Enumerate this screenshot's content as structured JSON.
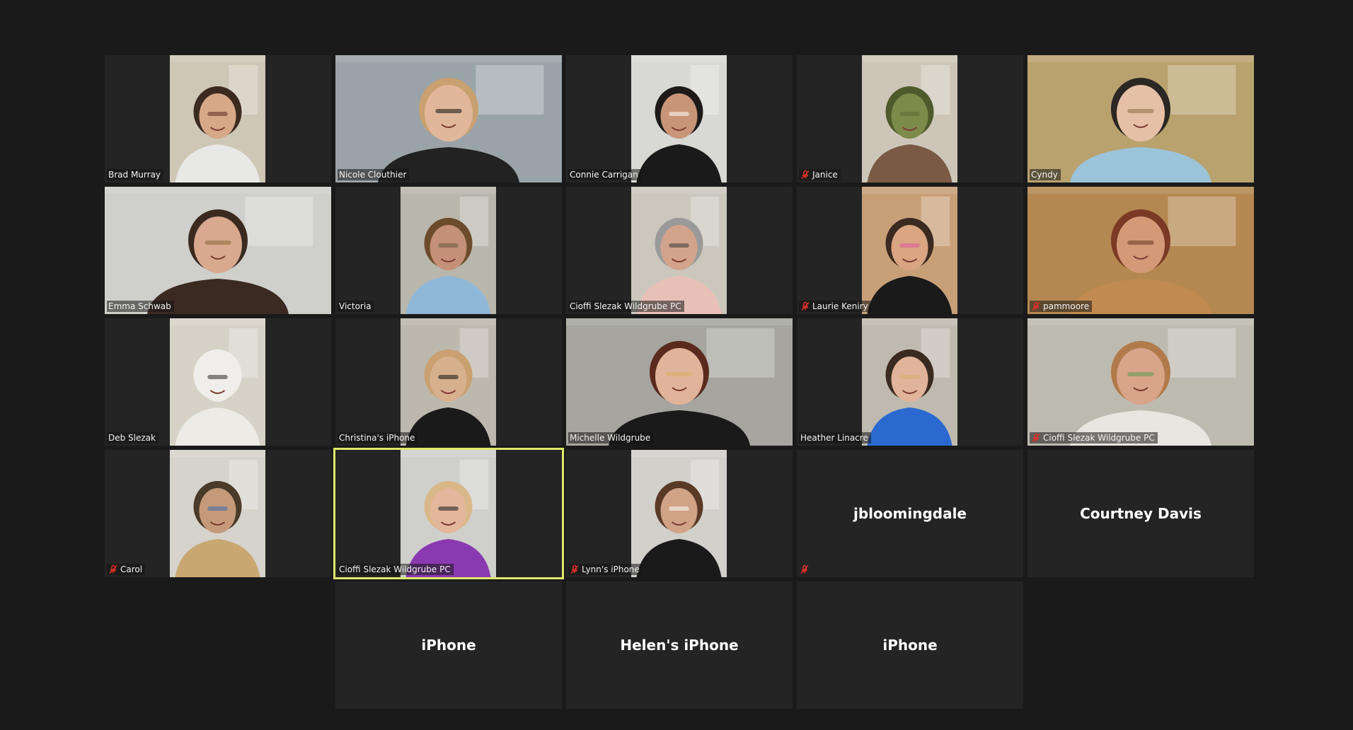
{
  "participants": [
    {
      "name": "Brad Murray",
      "muted": false,
      "video": "narrow",
      "scene": {
        "wall": "#cfc7b6",
        "skin": "#d7a888",
        "hair": "#3a2a20",
        "clothes": "#e8e8e6",
        "accent": "#5a2a22"
      }
    },
    {
      "name": "Nicole Clouthier",
      "muted": false,
      "video": "full",
      "scene": {
        "wall": "#9aa3a7",
        "skin": "#e1b79b",
        "hair": "#c9a070",
        "clothes": "#222222",
        "accent": "#111111"
      }
    },
    {
      "name": "Connie Carrigan",
      "muted": false,
      "video": "narrow",
      "scene": {
        "wall": "#d8d8d4",
        "skin": "#c99578",
        "hair": "#1d1a19",
        "clothes": "#1a1a1a",
        "accent": "#ffffff"
      }
    },
    {
      "name": "Janice",
      "muted": true,
      "video": "narrow",
      "scene": {
        "wall": "#cdc6b8",
        "skin": "#7c8a4a",
        "hair": "#4e5a2c",
        "clothes": "#7a5a44",
        "accent": "#5d6b35"
      }
    },
    {
      "name": "Cyndy",
      "muted": false,
      "video": "full",
      "scene": {
        "wall": "#b9a26e",
        "skin": "#e6c0a6",
        "hair": "#2b2723",
        "clothes": "#9cc4d8",
        "accent": "#8a6a44"
      }
    },
    {
      "name": "Emma Schwab",
      "muted": false,
      "video": "full",
      "scene": {
        "wall": "#cfcfcc",
        "skin": "#d8a98f",
        "hair": "#3a2a20",
        "clothes": "#3b2a22",
        "accent": "#8a6a3a"
      }
    },
    {
      "name": "Victoria",
      "muted": false,
      "video": "narrow",
      "scene": {
        "wall": "#b9b6ac",
        "skin": "#c49077",
        "hair": "#6b4b2a",
        "clothes": "#8fb8d8",
        "accent": "#6a5a40"
      }
    },
    {
      "name": "Cioffi Slezak Wildgrube PC",
      "muted": false,
      "video": "narrow",
      "scene": {
        "wall": "#cbc7bd",
        "skin": "#d2a48c",
        "hair": "#9a9a9a",
        "clothes": "#e8c0b8",
        "accent": "#3a3a3a"
      }
    },
    {
      "name": "Laurie Keniry",
      "muted": true,
      "video": "narrow",
      "scene": {
        "wall": "#c8a078",
        "skin": "#d9a582",
        "hair": "#3b2a20",
        "clothes": "#1a1a1a",
        "accent": "#e05aa0"
      }
    },
    {
      "name": "pammoore",
      "muted": true,
      "video": "full",
      "scene": {
        "wall": "#b48850",
        "skin": "#d49a78",
        "hair": "#7a3a26",
        "clothes": "#c08a50",
        "accent": "#6a3520"
      }
    },
    {
      "name": "Deb Slezak",
      "muted": false,
      "video": "narrow",
      "scene": {
        "wall": "#d6d2c8",
        "skin": "#f0eeea",
        "hair": "#f0eeea",
        "clothes": "#ecebe6",
        "accent": "#2a2a2a"
      }
    },
    {
      "name": "Christina's iPhone",
      "muted": false,
      "video": "narrow",
      "scene": {
        "wall": "#bdb8ae",
        "skin": "#d7b08e",
        "hair": "#c9a070",
        "clothes": "#1a1a1a",
        "accent": "#111111"
      }
    },
    {
      "name": "Michelle Wildgrube",
      "muted": false,
      "video": "full",
      "scene": {
        "wall": "#a6a59f",
        "skin": "#e0b49a",
        "hair": "#5a2a1e",
        "clothes": "#1a1a1a",
        "accent": "#d8b060"
      }
    },
    {
      "name": "Heather Linacre",
      "muted": false,
      "video": "narrow",
      "scene": {
        "wall": "#bfbab0",
        "skin": "#e0b49a",
        "hair": "#3a2a20",
        "clothes": "#2a6ad0",
        "accent": "#d6b070"
      }
    },
    {
      "name": "Cioffi Slezak Wildgrube PC",
      "muted": true,
      "video": "full",
      "scene": {
        "wall": "#bdbab0",
        "skin": "#d8a48a",
        "hair": "#b07a4a",
        "clothes": "#e8e6e0",
        "accent": "#5a9a4a"
      }
    },
    {
      "name": "Carol",
      "muted": true,
      "video": "narrow",
      "scene": {
        "wall": "#d6d3cc",
        "skin": "#c59a7a",
        "hair": "#4a3a2a",
        "clothes": "#c8a870",
        "accent": "#3a6ab0"
      }
    },
    {
      "name": "Cioffi Slezak Wildgrube PC",
      "muted": false,
      "video": "narrow",
      "active": true,
      "scene": {
        "wall": "#cfcfcc",
        "skin": "#e3b79b",
        "hair": "#d8b888",
        "clothes": "#8a3ab0",
        "accent": "#1a1a1a"
      }
    },
    {
      "name": "Lynn's iPhone",
      "muted": true,
      "video": "narrow",
      "scene": {
        "wall": "#d2d0cb",
        "skin": "#d0a286",
        "hair": "#5a3a26",
        "clothes": "#1a1a1a",
        "accent": "#ffffff"
      }
    },
    {
      "name": "jbloomingdale",
      "muted": true,
      "video": "none"
    },
    {
      "name": "Courtney Davis",
      "muted": false,
      "video": "none"
    },
    {
      "name": "iPhone",
      "muted": false,
      "video": "none"
    },
    {
      "name": "Helen's iPhone",
      "muted": false,
      "video": "none"
    },
    {
      "name": "iPhone",
      "muted": false,
      "video": "none"
    }
  ],
  "colors": {
    "background": "#1a1a1a",
    "tile": "#242424",
    "active_border": "#dde86a",
    "mute_icon": "#e0302a"
  }
}
